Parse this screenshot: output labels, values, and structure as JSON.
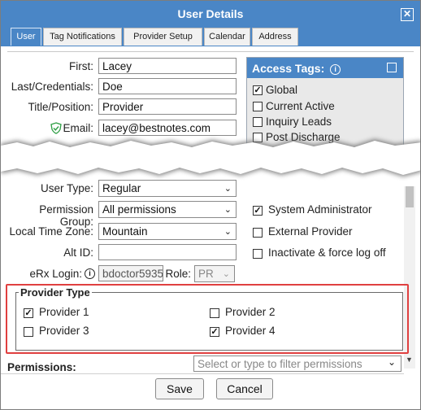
{
  "window": {
    "title": "User Details",
    "close_glyph": "✕"
  },
  "tabs": [
    "User",
    "Tag Notifications",
    "Provider Setup",
    "Calendar",
    "Address"
  ],
  "form": {
    "first_label": "First:",
    "first_value": "Lacey",
    "last_label": "Last/Credentials:",
    "last_value": "Doe",
    "title_label": "Title/Position:",
    "title_value": "Provider",
    "email_label": "Email:",
    "email_value": "lacey@bestnotes.com",
    "user_type_label": "User Type:",
    "user_type_value": "Regular",
    "permission_group_label": "Permission Group:",
    "permission_group_value": "All permissions",
    "time_zone_label": "Local Time Zone:",
    "time_zone_value": "Mountain",
    "alt_id_label": "Alt ID:",
    "alt_id_value": "",
    "erx_login_label": "eRx Login:",
    "erx_login_value": "bdoctor5935",
    "role_label": "Role:",
    "role_value": "PR"
  },
  "access_tags": {
    "title": "Access Tags:",
    "items": [
      {
        "label": "Global",
        "checked": true
      },
      {
        "label": "Current Active",
        "checked": false
      },
      {
        "label": "Inquiry Leads",
        "checked": false
      },
      {
        "label": "Post Discharge",
        "checked": false
      }
    ]
  },
  "options": [
    {
      "label": "System Administrator",
      "checked": true
    },
    {
      "label": "External Provider",
      "checked": false
    },
    {
      "label": "Inactivate & force log off",
      "checked": false
    }
  ],
  "provider_type": {
    "legend": "Provider Type",
    "items": [
      {
        "label": "Provider 1",
        "checked": true
      },
      {
        "label": "Provider 2",
        "checked": false
      },
      {
        "label": "Provider 3",
        "checked": false
      },
      {
        "label": "Provider 4",
        "checked": true
      }
    ]
  },
  "permissions": {
    "label": "Permissions:",
    "placeholder": "Select or type to filter permissions"
  },
  "buttons": {
    "save": "Save",
    "cancel": "Cancel"
  },
  "icons": {
    "info": "i",
    "chevron": "⌄",
    "check": "✓"
  },
  "colors": {
    "header_blue": "#4a86c6",
    "highlight_red": "#e04040",
    "shield_green": "#2e9e44"
  }
}
